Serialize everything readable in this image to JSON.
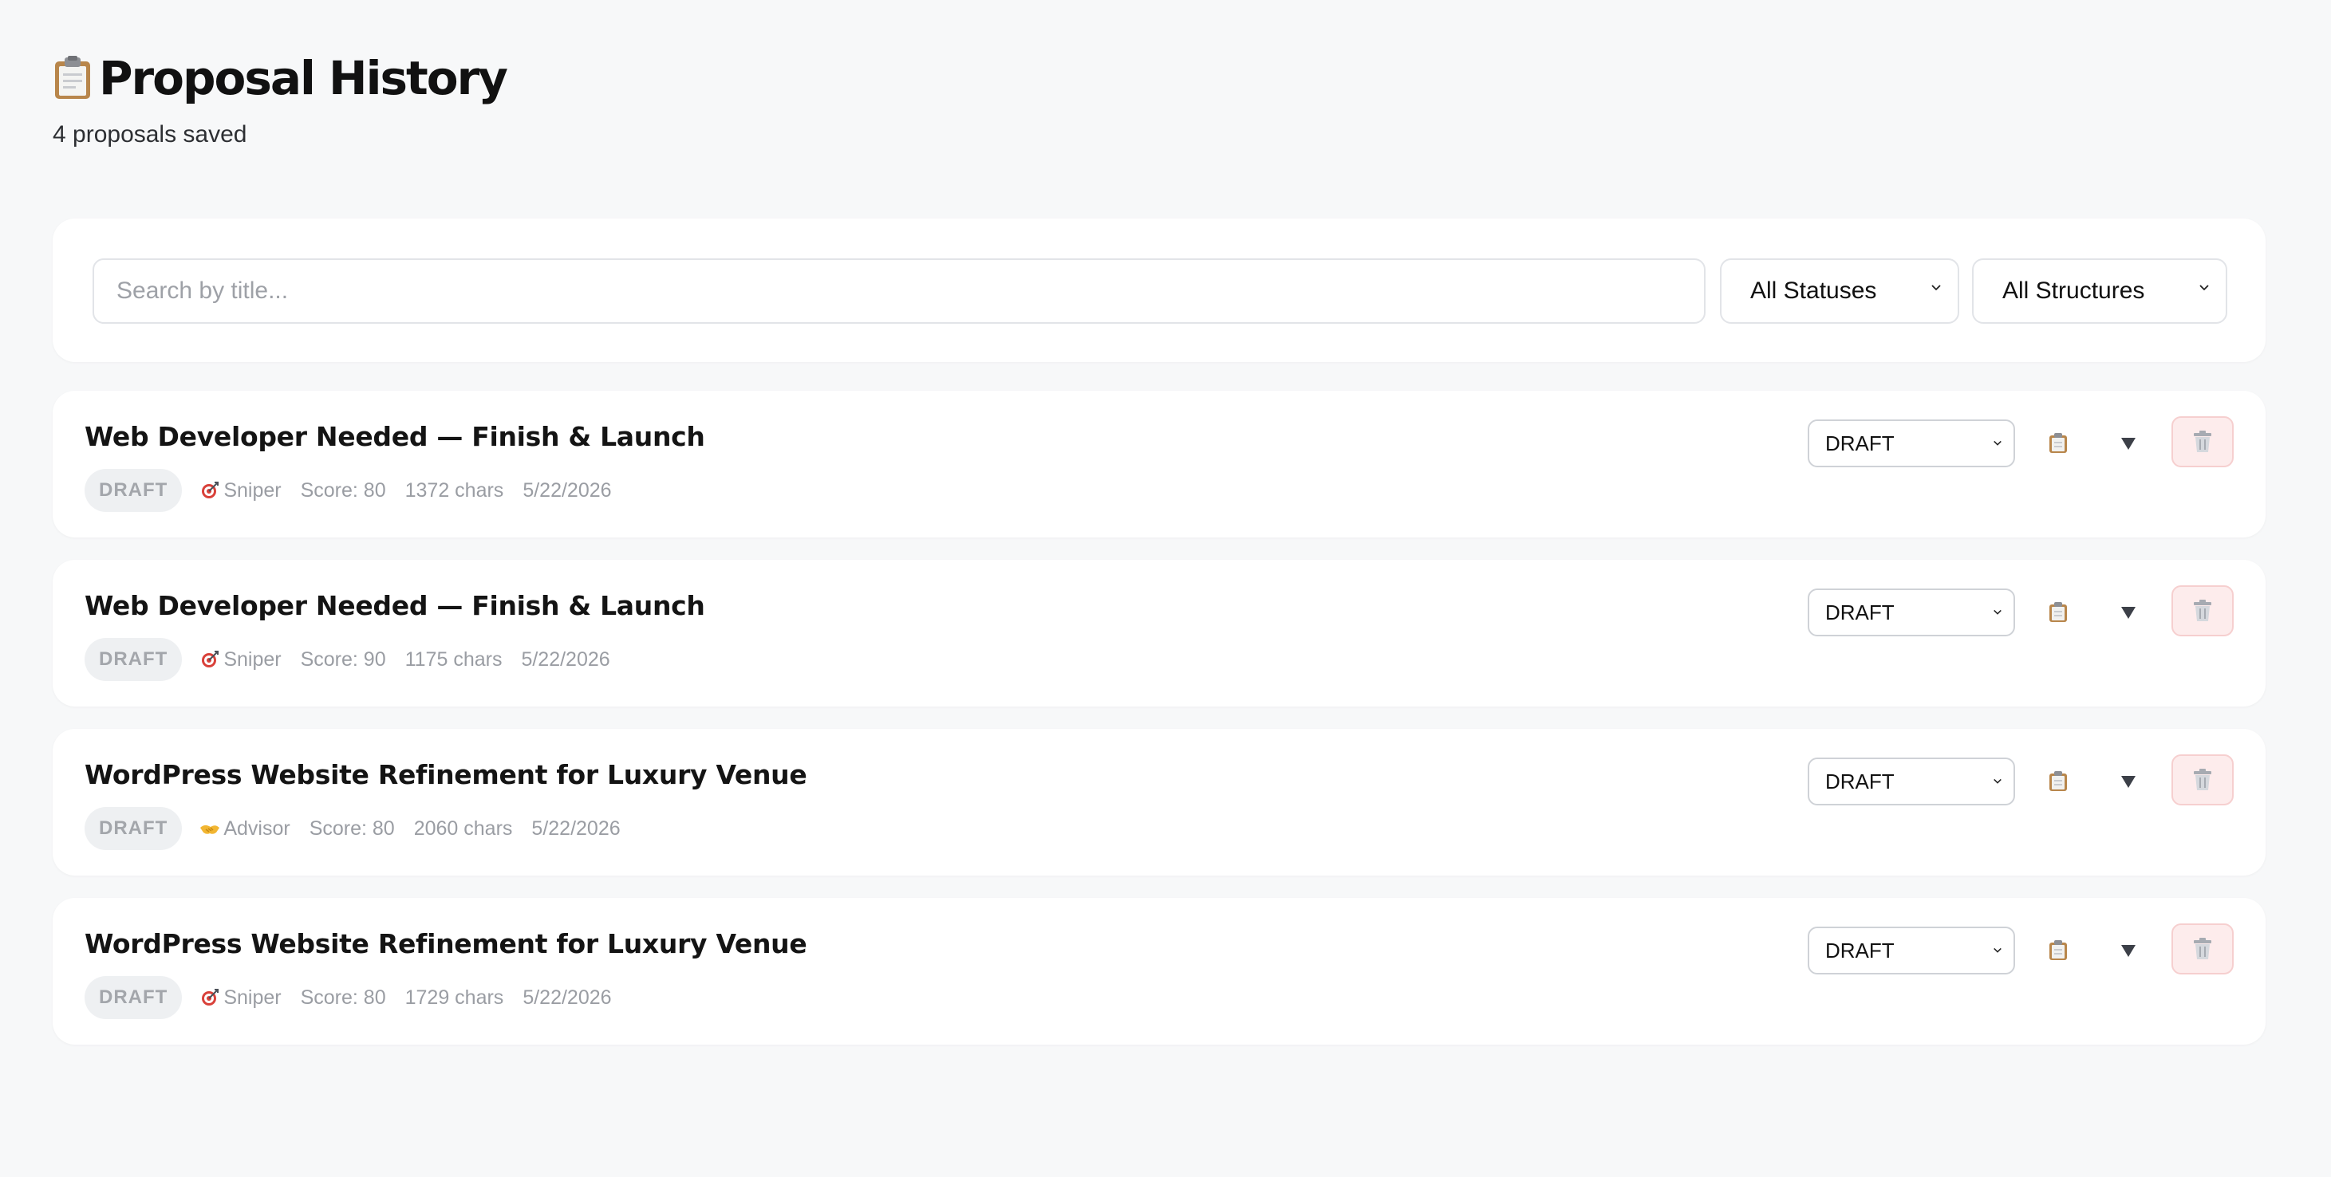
{
  "header": {
    "title": "Proposal History",
    "subtitle": "4 proposals saved",
    "icon": "clipboard-icon"
  },
  "filters": {
    "search_placeholder": "Search by title...",
    "search_value": "",
    "status_selected": "All Statuses",
    "structure_selected": "All Structures"
  },
  "proposals": [
    {
      "title": "Web Developer Needed — Finish & Launch",
      "status_badge": "DRAFT",
      "structure": "Sniper",
      "structure_icon": "target-icon",
      "score": "Score: 80",
      "chars": "1372 chars",
      "date": "5/22/2026",
      "status_select": "DRAFT"
    },
    {
      "title": "Web Developer Needed — Finish & Launch",
      "status_badge": "DRAFT",
      "structure": "Sniper",
      "structure_icon": "target-icon",
      "score": "Score: 90",
      "chars": "1175 chars",
      "date": "5/22/2026",
      "status_select": "DRAFT"
    },
    {
      "title": "WordPress Website Refinement for Luxury Venue",
      "status_badge": "DRAFT",
      "structure": "Advisor",
      "structure_icon": "handshake-icon",
      "score": "Score: 80",
      "chars": "2060 chars",
      "date": "5/22/2026",
      "status_select": "DRAFT"
    },
    {
      "title": "WordPress Website Refinement for Luxury Venue",
      "status_badge": "DRAFT",
      "structure": "Sniper",
      "structure_icon": "target-icon",
      "score": "Score: 80",
      "chars": "1729 chars",
      "date": "5/22/2026",
      "status_select": "DRAFT"
    }
  ],
  "colors": {
    "page_background": "#f7f8f9",
    "card_background": "#ffffff",
    "badge_background": "#eef0f2",
    "delete_background": "#fdecec",
    "delete_border": "#f6cfcf"
  }
}
